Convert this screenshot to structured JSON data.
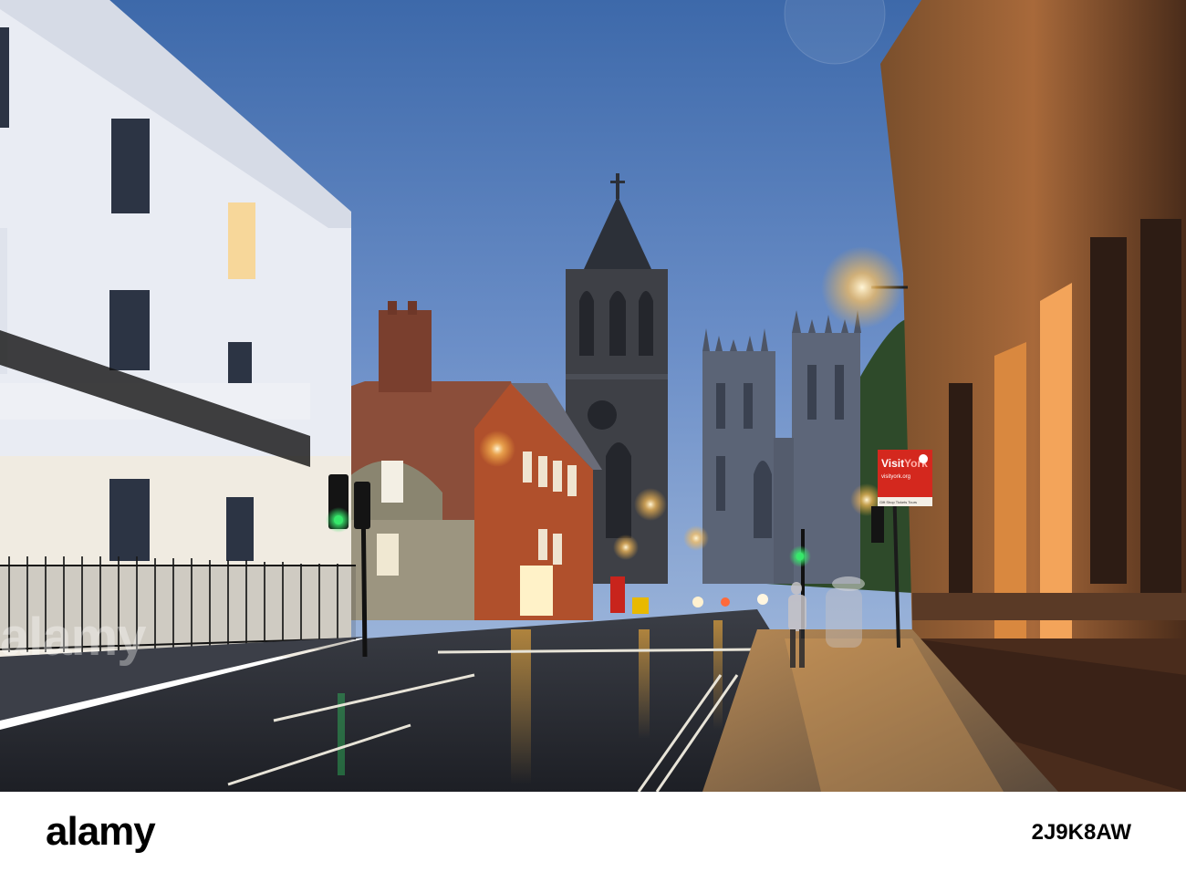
{
  "photo": {
    "sky_top": "#3f6dad",
    "sky_bottom": "#93add8",
    "street_light_color": "#ffb43a",
    "traffic_light_color": "#35e86a",
    "signage": {
      "visit_york_primary": "Visit",
      "visit_york_secondary": "York",
      "visit_york_url": "visityork.org",
      "visit_york_services": "Gift Shop    Tickets    Tours"
    }
  },
  "watermark": "alamy",
  "footer": {
    "logo": "alamy",
    "image_id": "2J9K8AW"
  }
}
